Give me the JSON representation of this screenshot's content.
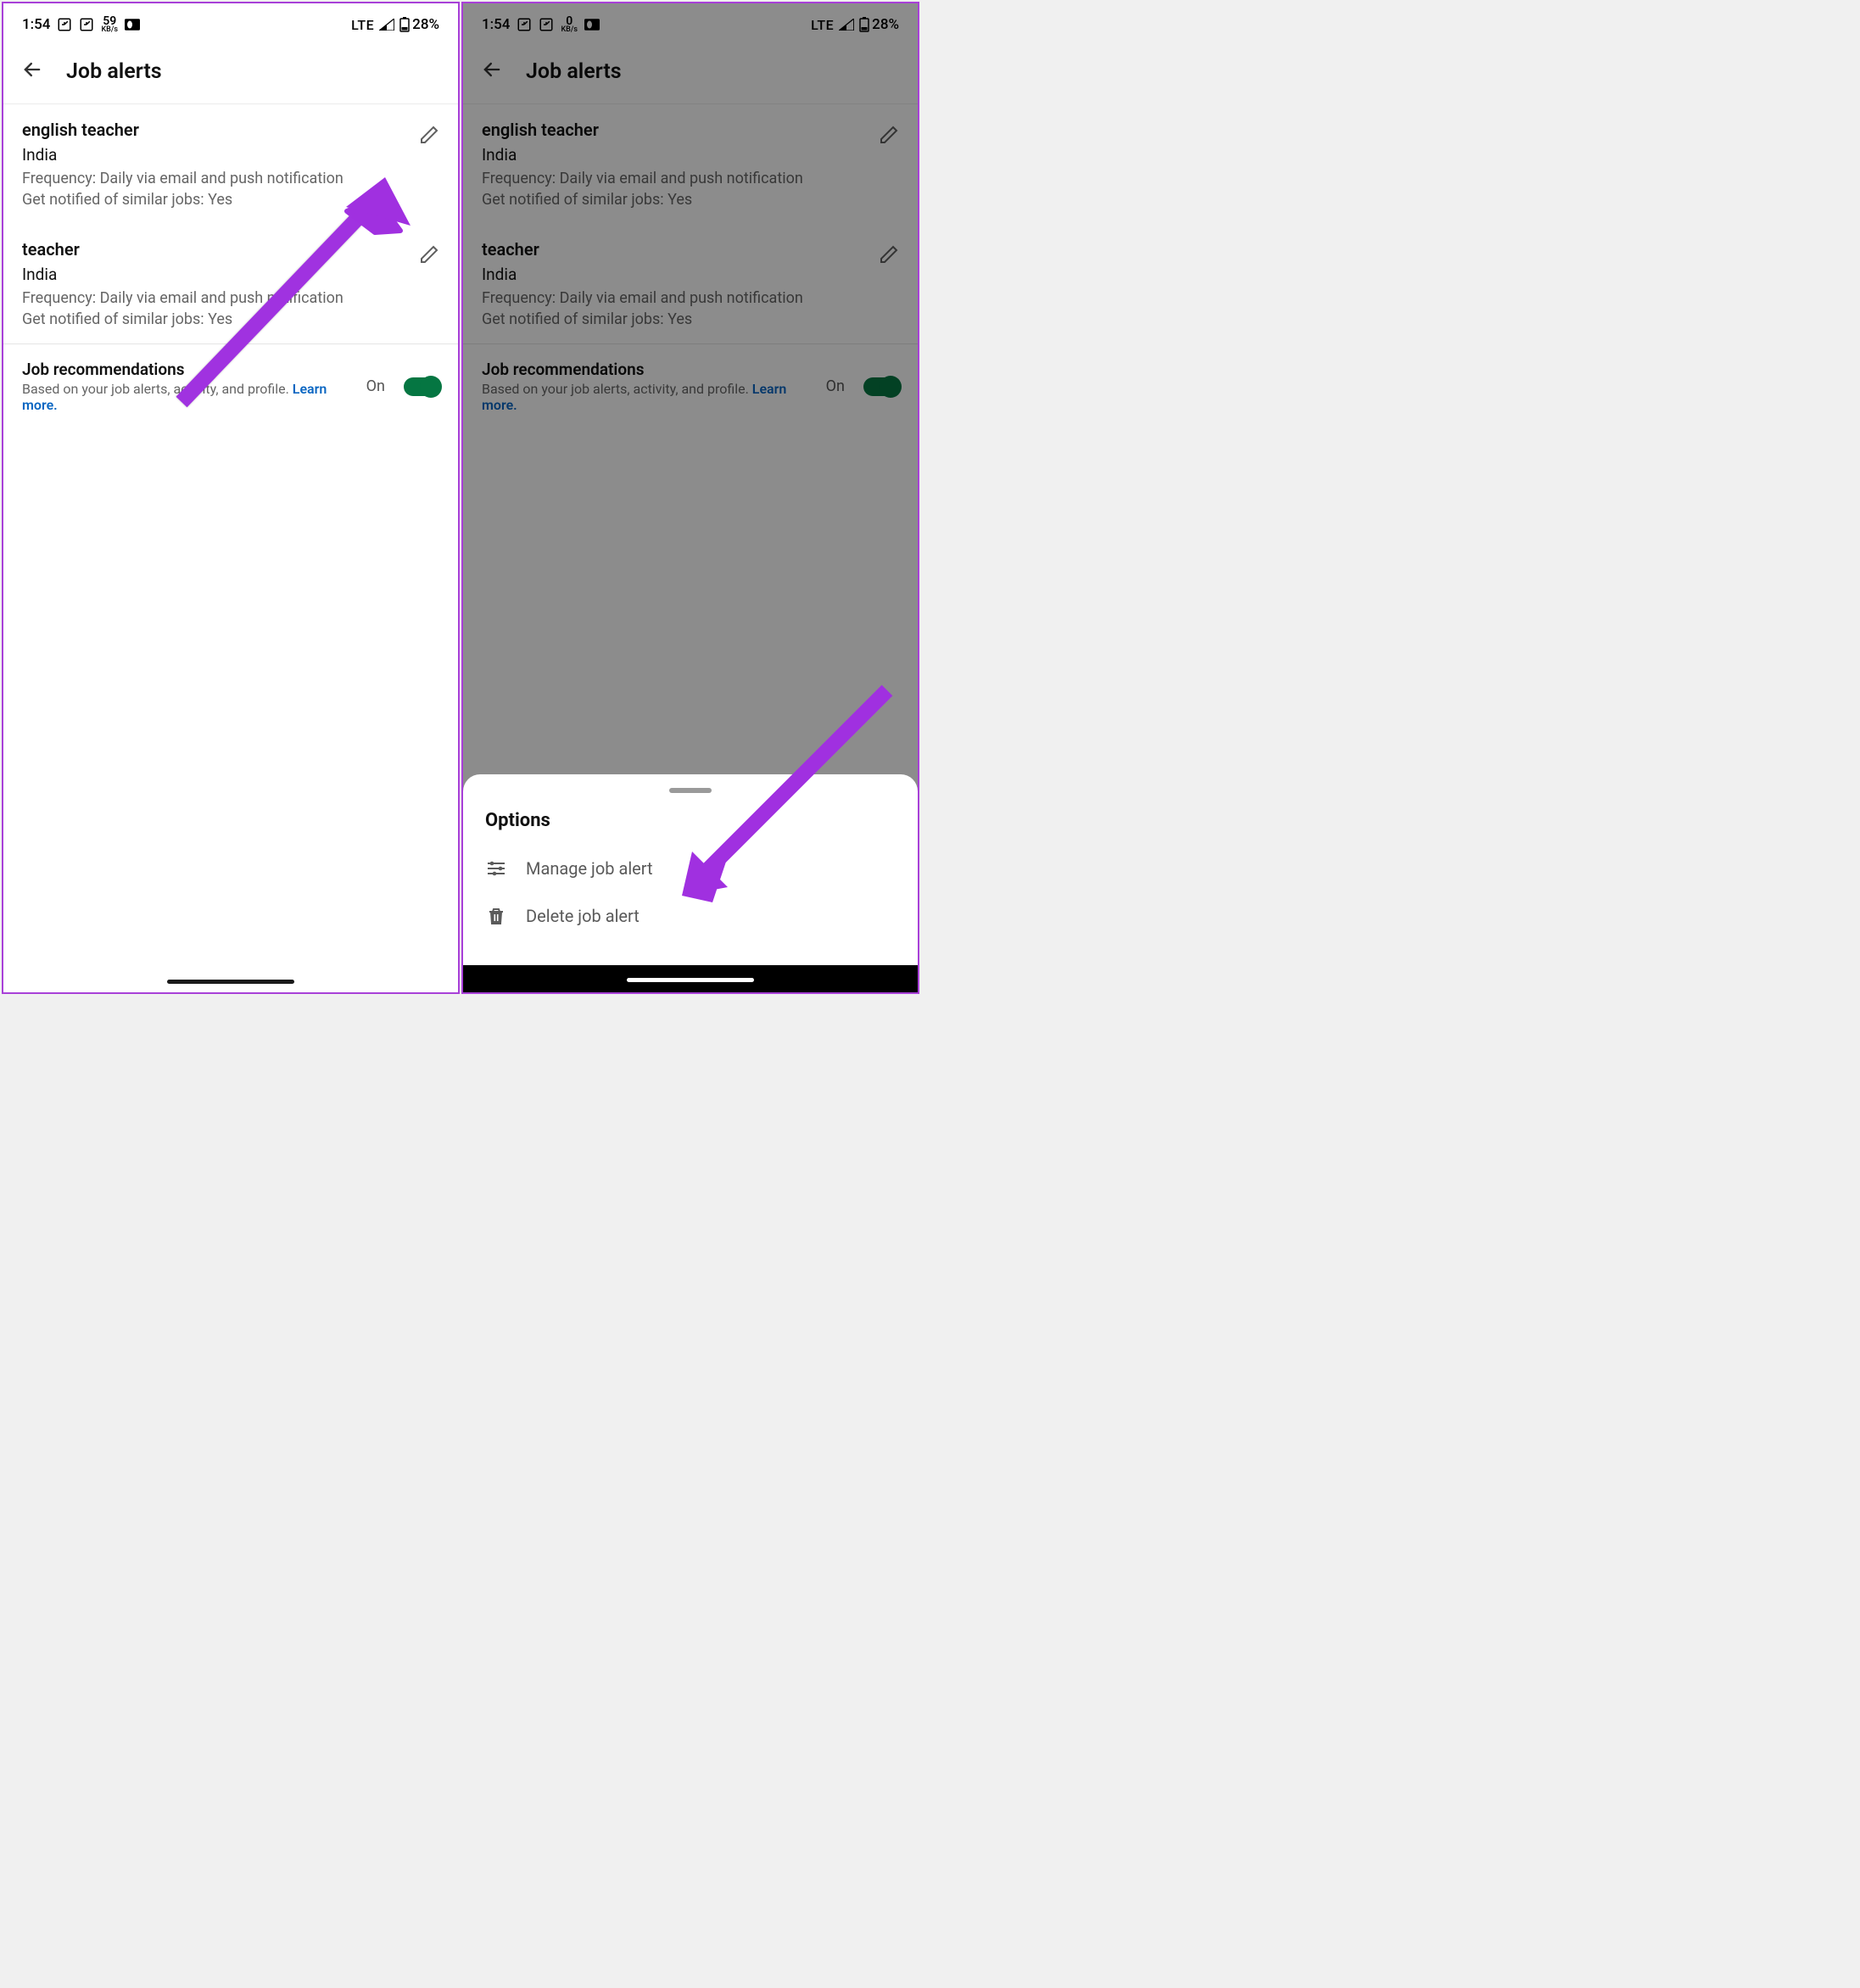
{
  "status": {
    "time": "1:54",
    "kbs1": "59",
    "kbs2": "0",
    "kbu": "KB/s",
    "network": "LTE",
    "battery": "28%"
  },
  "header": {
    "title": "Job alerts"
  },
  "alerts": [
    {
      "name": "english teacher",
      "location": "India",
      "freq": "Frequency: Daily via email and push notification",
      "similar": "Get notified of similar jobs: Yes"
    },
    {
      "name": "teacher",
      "location": "India",
      "freq": "Frequency: Daily via email and push notification",
      "similar": "Get notified of similar jobs: Yes"
    }
  ],
  "rec": {
    "title": "Job recommendations",
    "desc": "Based on your job alerts, activity, and profile.",
    "learn": "Learn more.",
    "state": "On"
  },
  "sheet": {
    "title": "Options",
    "manage": "Manage job alert",
    "delete": "Delete job alert"
  },
  "colors": {
    "accent": "#a840d8",
    "link": "#0a66c2",
    "toggle": "#057642"
  }
}
